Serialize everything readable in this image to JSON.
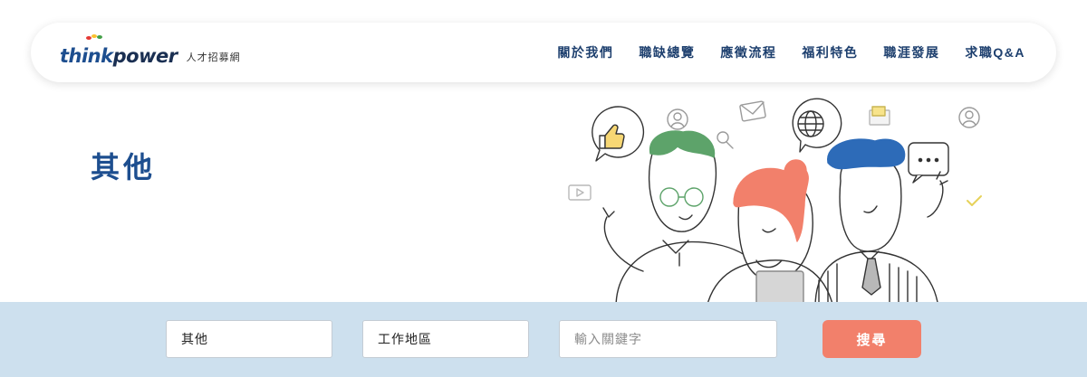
{
  "brand": {
    "think": "think",
    "power": "power",
    "subtitle": "人才招募網"
  },
  "nav": {
    "items": [
      {
        "label": "關於我們"
      },
      {
        "label": "職缺總覽"
      },
      {
        "label": "應徵流程"
      },
      {
        "label": "福利特色"
      },
      {
        "label": "職涯發展"
      },
      {
        "label": "求職Q&A"
      }
    ]
  },
  "page": {
    "title": "其他"
  },
  "search": {
    "category_value": "其他",
    "location_value": "工作地區",
    "keyword_placeholder": "輸入關鍵字",
    "button_label": "搜尋"
  },
  "colors": {
    "brand_blue": "#1d4e8f",
    "search_bg": "#cde0ee",
    "button": "#f2806b"
  }
}
